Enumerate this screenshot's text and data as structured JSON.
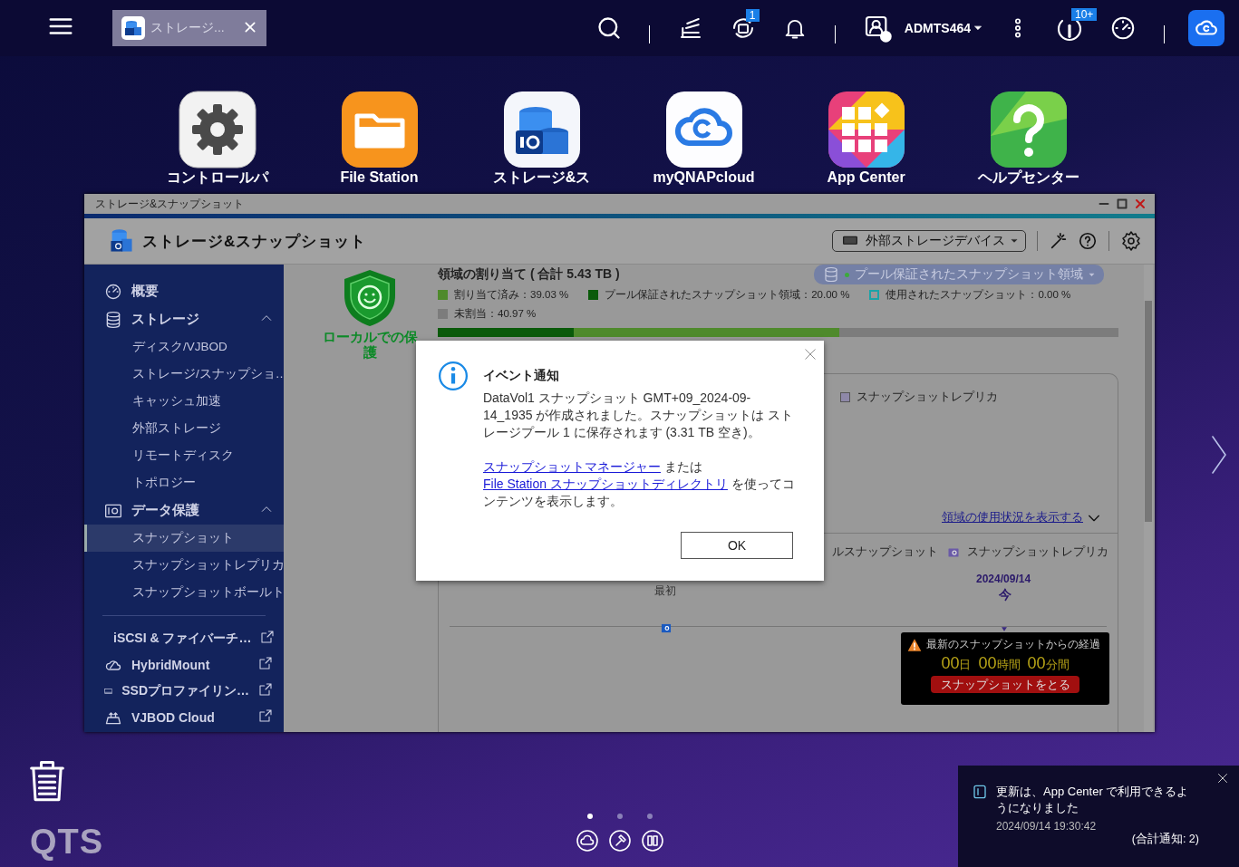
{
  "topbar": {
    "tab": {
      "label": "ストレージ..."
    },
    "user": "ADMTS464",
    "backup_badge": "1",
    "info_badge": "10+"
  },
  "desktop_apps": [
    {
      "label": "コントロールパ"
    },
    {
      "label": "File Station"
    },
    {
      "label": "ストレージ&ス"
    },
    {
      "label": "myQNAPcloud"
    },
    {
      "label": "App Center"
    },
    {
      "label": "ヘルプセンター"
    }
  ],
  "window": {
    "title": "ストレージ&スナップショット",
    "app_title": "ストレージ&スナップショット",
    "device_menu": "外部ストレージデバイス",
    "sidebar": [
      {
        "kind": "plain",
        "label": "概要"
      },
      {
        "kind": "section",
        "label": "ストレージ",
        "expanded": true,
        "children": [
          {
            "label": "ディスク/VJBOD",
            "selected": false
          },
          {
            "label": "ストレージ/スナップショ…",
            "selected": false
          },
          {
            "label": "キャッシュ加速",
            "selected": false
          },
          {
            "label": "外部ストレージ",
            "selected": false
          },
          {
            "label": "リモートディスク",
            "selected": false
          },
          {
            "label": "トポロジー",
            "selected": false
          }
        ]
      },
      {
        "kind": "section",
        "label": "データ保護",
        "expanded": true,
        "children": [
          {
            "label": "スナップショット",
            "selected": true
          },
          {
            "label": "スナップショットレプリカ",
            "selected": false
          },
          {
            "label": "スナップショットボールト",
            "selected": false
          }
        ]
      },
      {
        "kind": "divider"
      },
      {
        "kind": "external",
        "label": "iSCSI & ファイバーチ…"
      },
      {
        "kind": "external",
        "label": "HybridMount"
      },
      {
        "kind": "external",
        "label": "SSDプロファイリン…"
      },
      {
        "kind": "external",
        "label": "VJBOD Cloud"
      }
    ],
    "content": {
      "status": "ローカルでの保護",
      "allocation_title": "領域の割り当て ( 合計 5.43 TB )",
      "space_menu": "プール保証されたスナップショット領域",
      "legend": [
        {
          "kind": "solid",
          "label": "割り当て済み：39.03 %",
          "color": "#4f8a2c"
        },
        {
          "kind": "solid",
          "label": "プール保証されたスナップショット領域：20.00 %",
          "color": "#0a5a0a"
        },
        {
          "kind": "outline",
          "label": "使用されたスナップショット：0.00 %",
          "color": "#1aa3a8"
        },
        {
          "kind": "solid",
          "label": "未割当：40.97 %",
          "color": "#7c7c7c"
        }
      ],
      "bar": [
        {
          "level": 0.5903,
          "color": "#4f8a2c"
        },
        {
          "level": 0.2,
          "color": "#0a5a0a"
        }
      ],
      "panel_legend": [
        {
          "label": "スナップショットレプリカ",
          "color": "#8e88a8"
        }
      ],
      "usage_link": "領域の使用状況を表示する",
      "tabs": [
        {
          "label": "ルスナップショット"
        },
        {
          "label": "スナップショットレプリカ"
        }
      ],
      "timeline": {
        "first": "最初",
        "date": "2024/09/14",
        "now": "今"
      },
      "alert": {
        "text": "最新のスナップショットからの経過",
        "elapsed": [
          {
            "value": "00",
            "unit": "日"
          },
          {
            "value": "00",
            "unit": "時間"
          },
          {
            "value": "00",
            "unit": "分間"
          }
        ],
        "button": "スナップショットをとる"
      }
    },
    "dialog": {
      "title": "イベント通知",
      "message": "DataVol1 スナップショット GMT+09_2024-09-14_1935 が作成されました。スナップショットは ストレージプール 1 に保存されます (3.31 TB 空き)。",
      "parts": [
        {
          "kind": "link",
          "text": "スナップショットマネージャー"
        },
        {
          "kind": "text",
          "text": " または "
        },
        {
          "kind": "link",
          "text": "File Station スナップショットディレクトリ"
        },
        {
          "kind": "text",
          "text": " を使ってコンテンツを表示します。"
        }
      ],
      "button": "OK"
    }
  },
  "notification": {
    "message": "更新は、App Center で利用できるようになりました",
    "time": "2024/09/14 19:30:42",
    "total": "(合計通知: 2)"
  },
  "dock": {
    "pages": [
      {
        "selected": true
      },
      {
        "selected": false
      },
      {
        "selected": false
      }
    ]
  },
  "brand": "QTS"
}
